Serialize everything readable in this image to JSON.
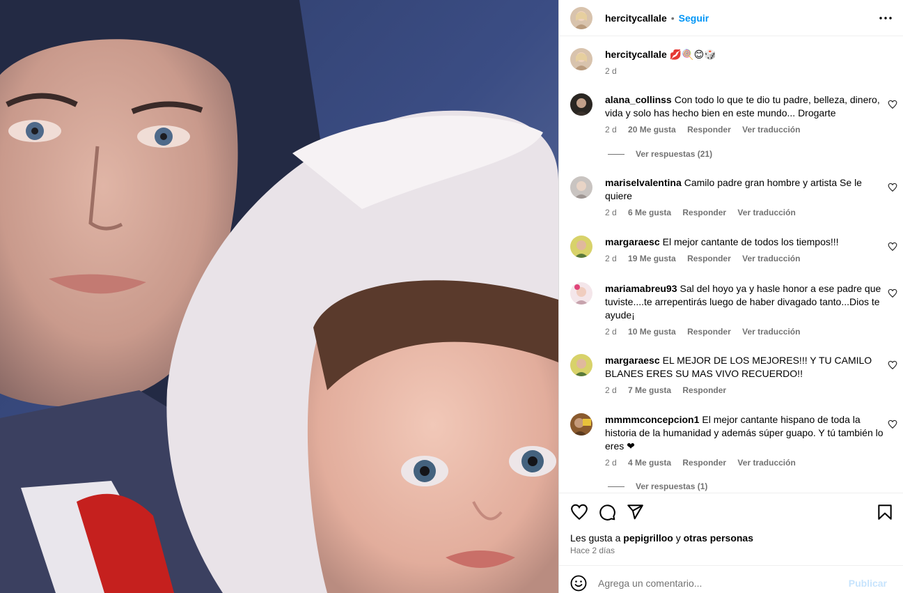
{
  "post": {
    "author": "hercitycallale",
    "follow_label": "Seguir",
    "caption_emoji": "💋🍭😊🎲",
    "caption_time": "2 d"
  },
  "comments": [
    {
      "user": "alana_collinss",
      "text": "Con todo lo que te dio tu padre, belleza, dinero, vida y solo has hecho bien en este mundo... Drogarte",
      "time": "2 d",
      "likes": "20 Me gusta",
      "reply": "Responder",
      "translate": "Ver traducción",
      "view_replies": "Ver respuestas (21)"
    },
    {
      "user": "mariselvalentina",
      "text": "Camilo padre gran hombre y artista Se le quiere",
      "time": "2 d",
      "likes": "6 Me gusta",
      "reply": "Responder",
      "translate": "Ver traducción"
    },
    {
      "user": "margaraesc",
      "text": "El mejor cantante de todos los tiempos!!!",
      "time": "2 d",
      "likes": "19 Me gusta",
      "reply": "Responder",
      "translate": "Ver traducción"
    },
    {
      "user": "mariamabreu93",
      "text": "Sal del hoyo ya y hasle honor a ese padre que tuviste....te arrepentirás luego de haber divagado tanto...Dios te ayude¡",
      "time": "2 d",
      "likes": "10 Me gusta",
      "reply": "Responder",
      "translate": "Ver traducción"
    },
    {
      "user": "margaraesc",
      "text": "EL MEJOR DE LOS MEJORES!!! Y TU CAMILO BLANES ERES SU MAS VIVO RECUERDO!!",
      "time": "2 d",
      "likes": "7 Me gusta",
      "reply": "Responder"
    },
    {
      "user": "mmmmconcepcion1",
      "text": "El mejor cantante hispano de toda la historia de la humanidad y además súper guapo. Y tú también lo eres ❤",
      "time": "2 d",
      "likes": "4 Me gusta",
      "reply": "Responder",
      "translate": "Ver traducción",
      "view_replies": "Ver respuestas (1)"
    }
  ],
  "footer": {
    "likes_prefix": "Les gusta a",
    "likes_user": "pepigrilloo",
    "likes_joiner": "y",
    "likes_others": "otras personas",
    "time_ago": "Hace 2 días",
    "comment_placeholder": "Agrega un comentario...",
    "publish_label": "Publicar"
  },
  "icons": {
    "header_more": "more-horizontal-icon",
    "like": "heart-icon",
    "comment": "comment-icon",
    "share": "send-icon",
    "save": "bookmark-icon",
    "emoji": "emoji-icon"
  },
  "colors": {
    "link_blue": "#0095f6",
    "publish_disabled": "#c7e4fd",
    "secondary_text": "#737373"
  }
}
